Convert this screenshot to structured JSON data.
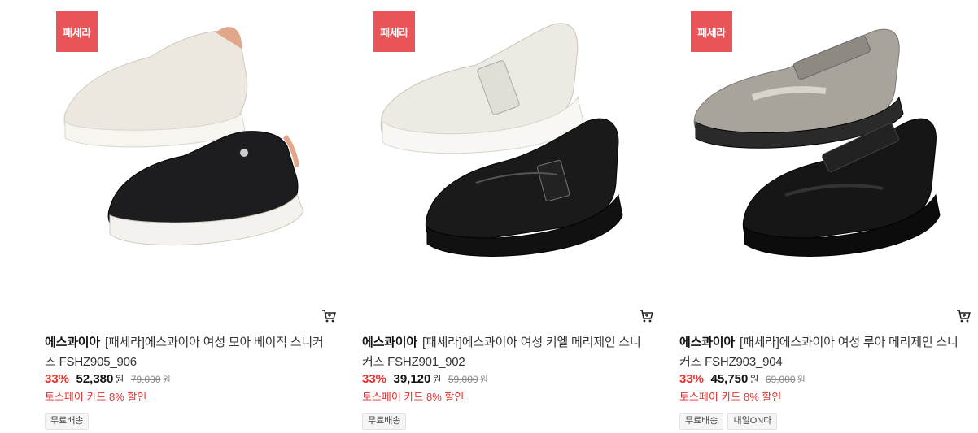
{
  "products": [
    {
      "badge": "패세라",
      "brand": "에스콰이아",
      "name": "[패세라]에스콰이아 여성 모아 베이직 스니커즈 FSHZ905_906",
      "discount": "33%",
      "price": "52,380",
      "price_unit": "원",
      "original_price": "79,000",
      "original_unit": "원",
      "promo": "토스페이 카드 8% 할인",
      "tags": [
        "무료배송"
      ],
      "cart_icon": "cart-icon"
    },
    {
      "badge": "패세라",
      "brand": "에스콰이아",
      "name": "[패세라]에스콰이아 여성 키엘 메리제인 스니커즈 FSHZ901_902",
      "discount": "33%",
      "price": "39,120",
      "price_unit": "원",
      "original_price": "59,000",
      "original_unit": "원",
      "promo": "토스페이 카드 8% 할인",
      "tags": [
        "무료배송"
      ],
      "cart_icon": "cart-icon"
    },
    {
      "badge": "패세라",
      "brand": "에스콰이아",
      "name": "[패세라]에스콰이아 여성 루아 메리제인 스니커즈 FSHZ903_904",
      "discount": "33%",
      "price": "45,750",
      "price_unit": "원",
      "original_price": "69,000",
      "original_unit": "원",
      "promo": "토스페이 카드 8% 할인",
      "tags": [
        "무료배송",
        "내일ON다"
      ],
      "cart_icon": "cart-icon"
    }
  ],
  "colors": {
    "badge_bg": "#e85458",
    "discount": "#e8312e",
    "promo": "#e8312e"
  }
}
